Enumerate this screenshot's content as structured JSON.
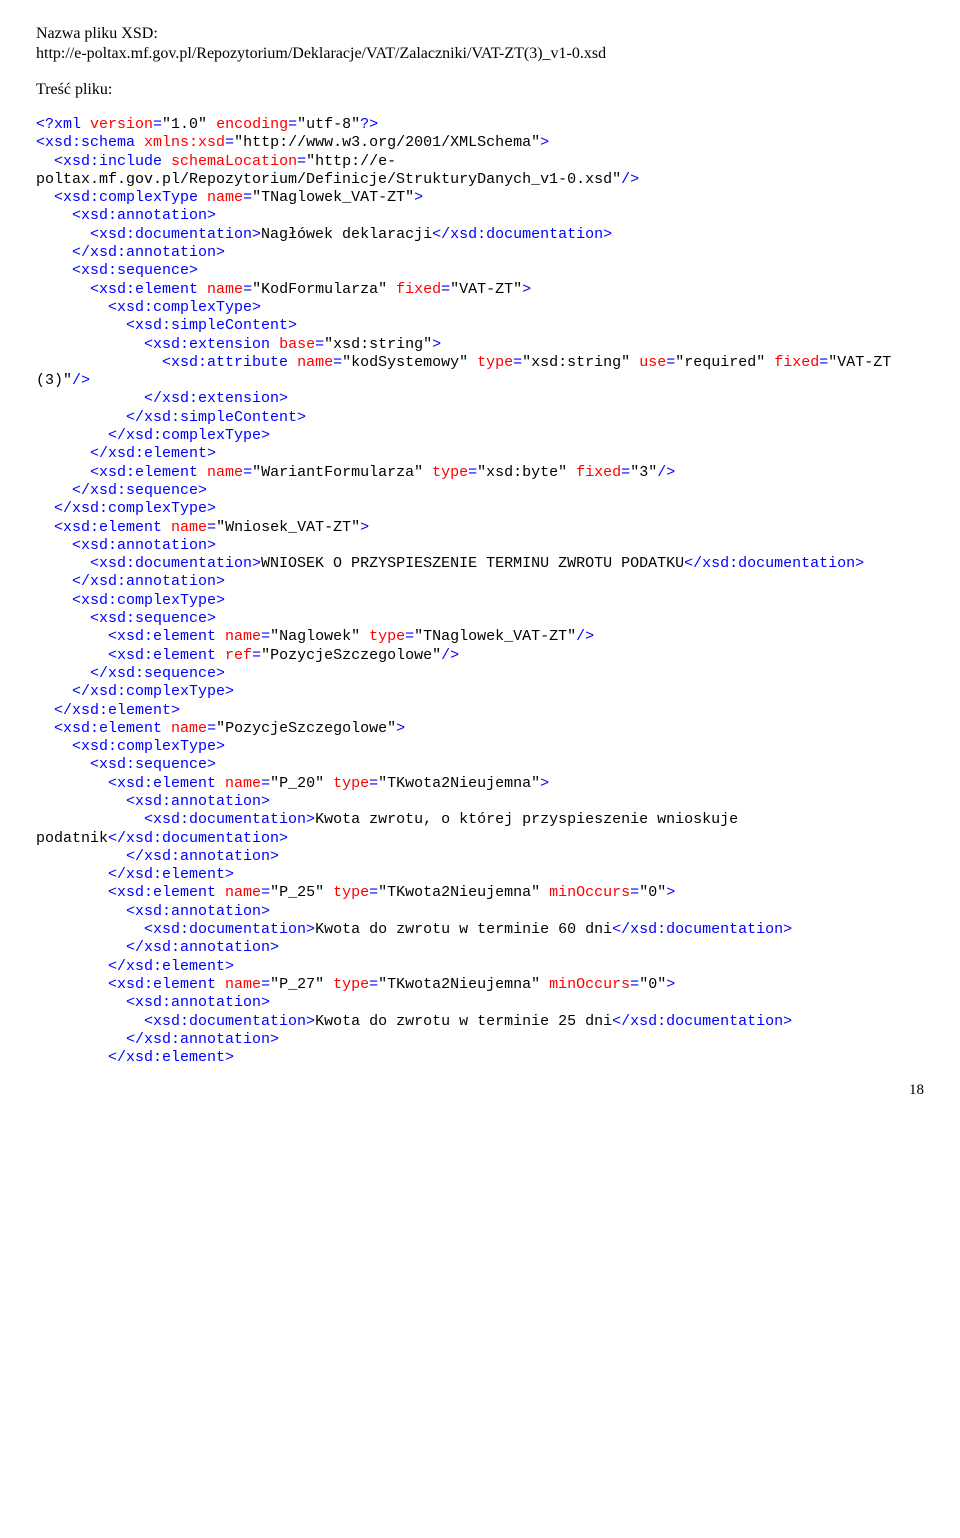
{
  "header": {
    "label": "Nazwa pliku XSD:",
    "url": "http://e-poltax.mf.gov.pl/Repozytorium/Deklaracje/VAT/Zalaczniki/VAT-ZT(3)_v1-0.xsd",
    "tresc": "Treść pliku:"
  },
  "pagenum": "18",
  "xml": {
    "l1": {
      "p1": "<?xml ",
      "attr1": "version",
      "v1": "\"1.0\"",
      "attr2": " encoding",
      "v2": "\"utf-8\"",
      "p2": "?>"
    },
    "l2": {
      "p1": "<xsd:schema ",
      "attr": "xmlns:xsd",
      "v": "\"http://www.w3.org/2001/XMLSchema\"",
      "p2": ">"
    },
    "l3": "  <xsd:include ",
    "l3a": {
      "attr": "schemaLocation",
      "v": "\"http://e-poltax.mf.gov.pl/Repozytorium/Definicje/StrukturyDanych_v1-0.xsd\"",
      "p2": "/>"
    },
    "l4": {
      "p1": "  <xsd:complexType ",
      "attr": "name",
      "v": "\"TNaglowek_VAT-ZT\"",
      "p2": ">"
    },
    "l5": "    <xsd:annotation>",
    "l6": {
      "p1": "      <xsd:documentation>",
      "txt": "Nagłówek deklaracji",
      "p2": "</xsd:documentation>"
    },
    "l7": "    </xsd:annotation>",
    "l8": "    <xsd:sequence>",
    "l9": {
      "p1": "      <xsd:element ",
      "a1": "name",
      "v1": "\"KodFormularza\"",
      "a2": " fixed",
      "v2": "\"VAT-ZT\"",
      "p2": ">"
    },
    "l10": "        <xsd:complexType>",
    "l11": "          <xsd:simpleContent>",
    "l12": {
      "p1": "            <xsd:extension ",
      "a": "base",
      "v": "\"xsd:string\"",
      "p2": ">"
    },
    "l13": {
      "p1": "              <xsd:attribute ",
      "a1": "name",
      "v1": "\"kodSystemowy\"",
      "a2": " type",
      "v2": "\"xsd:string\"",
      "a3": "use",
      "v3": "\"required\"",
      "a4": " fixed",
      "v4": "\"VAT-ZT (3)\"",
      "p2": "/>"
    },
    "l14": "            </xsd:extension>",
    "l15": "          </xsd:simpleContent>",
    "l16": "        </xsd:complexType>",
    "l17": "      </xsd:element>",
    "l18": {
      "p1": "      <xsd:element ",
      "a1": "name",
      "v1": "\"WariantFormularza\"",
      "a2": " type",
      "v2": "\"xsd:byte\"",
      "a3": " fixed",
      "v3": "\"3\"",
      "p2": "/>"
    },
    "l19": "    </xsd:sequence>",
    "l20": "  </xsd:complexType>",
    "l21": {
      "p1": "  <xsd:element ",
      "a": "name",
      "v": "\"Wniosek_VAT-ZT\"",
      "p2": ">"
    },
    "l22": "    <xsd:annotation>",
    "l23": {
      "p1": "      <xsd:documentation>",
      "txt": "WNIOSEK O PRZYSPIESZENIE TERMINU ZWROTU PODATKU",
      "p2": "</xsd:documentation>"
    },
    "l24": "    </xsd:annotation>",
    "l25": "    <xsd:complexType>",
    "l26": "      <xsd:sequence>",
    "l27": {
      "p1": "        <xsd:element ",
      "a1": "name",
      "v1": "\"Naglowek\"",
      "a2": " type",
      "v2": "\"TNaglowek_VAT-ZT\"",
      "p2": "/>"
    },
    "l28": {
      "p1": "        <xsd:element ",
      "a": "ref",
      "v": "\"PozycjeSzczegolowe\"",
      "p2": "/>"
    },
    "l29": "      </xsd:sequence>",
    "l30": "    </xsd:complexType>",
    "l31": "  </xsd:element>",
    "l32": {
      "p1": "  <xsd:element ",
      "a": "name",
      "v": "\"PozycjeSzczegolowe\"",
      "p2": ">"
    },
    "l33": "    <xsd:complexType>",
    "l34": "      <xsd:sequence>",
    "l35": {
      "p1": "        <xsd:element ",
      "a1": "name",
      "v1": "\"P_20\"",
      "a2": " type",
      "v2": "\"TKwota2Nieujemna\"",
      "p2": ">"
    },
    "l36": "          <xsd:annotation>",
    "l37": {
      "p1": "            <xsd:documentation>",
      "txt": "Kwota zwrotu, o której przyspieszenie wnioskuje podatnik",
      "p2": "</xsd:documentation>"
    },
    "l38": "          </xsd:annotation>",
    "l39": "        </xsd:element>",
    "l40": {
      "p1": "        <xsd:element ",
      "a1": "name",
      "v1": "\"P_25\"",
      "a2": " type",
      "v2": "\"TKwota2Nieujemna\"",
      "a3": " minOccurs",
      "v3": "\"0\"",
      "p2": ">"
    },
    "l41": "          <xsd:annotation>",
    "l42": {
      "p1": "            <xsd:documentation>",
      "txt": "Kwota do zwrotu w terminie 60 dni",
      "p2": "</xsd:documentation>"
    },
    "l43": "          </xsd:annotation>",
    "l44": "        </xsd:element>",
    "l45": {
      "p1": "        <xsd:element ",
      "a1": "name",
      "v1": "\"P_27\"",
      "a2": " type",
      "v2": "\"TKwota2Nieujemna\"",
      "a3": " minOccurs",
      "v3": "\"0\"",
      "p2": ">"
    },
    "l46": "          <xsd:annotation>",
    "l47": {
      "p1": "            <xsd:documentation>",
      "txt": "Kwota do zwrotu w terminie 25 dni",
      "p2": "</xsd:documentation>"
    },
    "l48": "          </xsd:annotation>",
    "l49": "        </xsd:element>"
  }
}
